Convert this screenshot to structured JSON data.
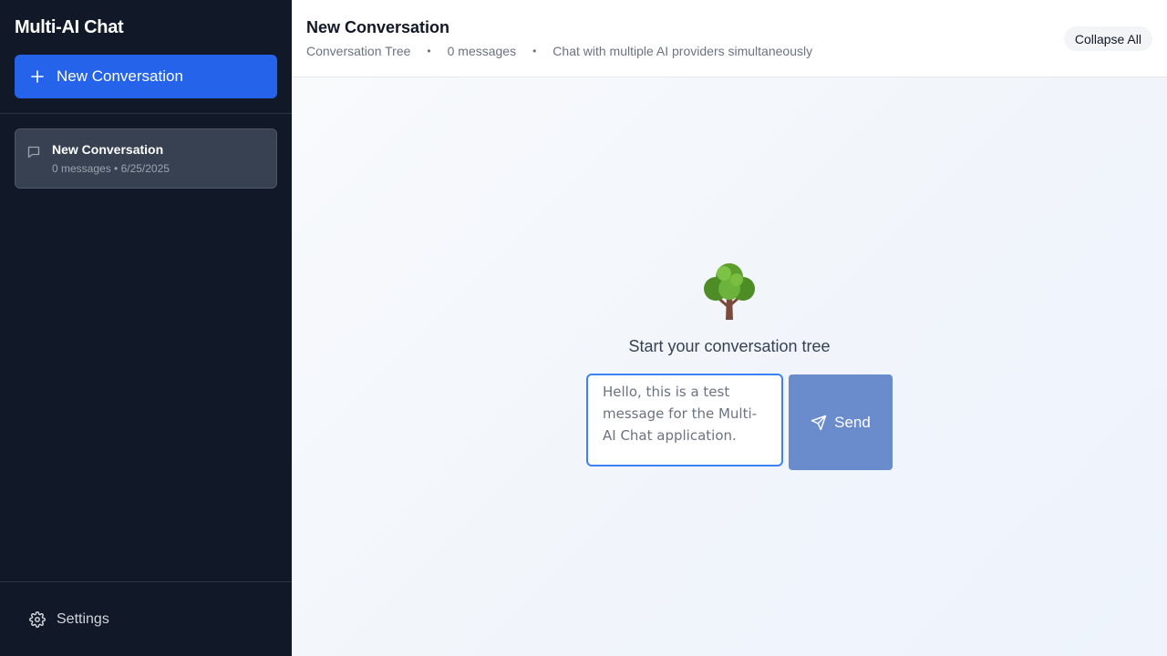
{
  "sidebar": {
    "app_title": "Multi-AI Chat",
    "new_conversation_label": "New Conversation",
    "conversations": [
      {
        "title": "New Conversation",
        "meta": "0 messages • 6/25/2025"
      }
    ],
    "settings_label": "Settings"
  },
  "header": {
    "title": "New Conversation",
    "view_label": "Conversation Tree",
    "message_count": "0 messages",
    "description": "Chat with multiple AI providers simultaneously",
    "collapse_all_label": "Collapse All"
  },
  "canvas": {
    "empty_icon": "tree-icon",
    "empty_text": "Start your conversation tree",
    "input_value": "Hello, this is a test message for the Multi-AI Chat application.",
    "send_label": "Send"
  },
  "colors": {
    "sidebar_bg": "#111827",
    "accent": "#2563eb",
    "send_button": "#6a8bcc",
    "input_border": "#3b82f6"
  }
}
